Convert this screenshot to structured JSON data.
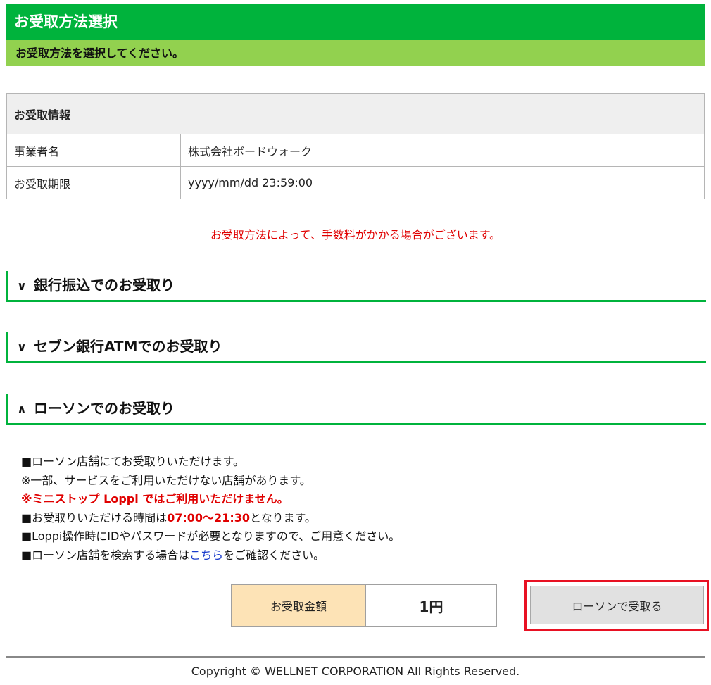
{
  "header": {
    "title": "お受取方法選択",
    "subtitle": "お受取方法を選択してください。"
  },
  "info": {
    "heading": "お受取情報",
    "rows": [
      {
        "label": "事業者名",
        "value": "株式会社ボードウォーク"
      },
      {
        "label": "お受取期限",
        "value": "yyyy/mm/dd 23:59:00"
      }
    ]
  },
  "notice": "お受取方法によって、手数料がかかる場合がございます。",
  "sections": [
    {
      "chevron": "∨",
      "title": "銀行振込でのお受取り",
      "expanded": false
    },
    {
      "chevron": "∨",
      "title": "セブン銀行ATMでのお受取り",
      "expanded": false
    },
    {
      "chevron": "∧",
      "title": "ローソンでのお受取り",
      "expanded": true
    }
  ],
  "lawson": {
    "line1": "■ローソン店舗にてお受取りいただけます。",
    "line2": "※一部、サービスをご利用いただけない店舗があります。",
    "line3": "※ミニストップ Loppi ではご利用いただけません。",
    "line4_prefix": "■お受取りいただける時間は",
    "line4_time": "07:00～21:30",
    "line4_suffix": "となります。",
    "line5": "■Loppi操作時にIDやパスワードが必要となりますので、ご用意ください。",
    "line6_prefix": "■ローソン店舗を検索する場合は",
    "line6_link": "こちら",
    "line6_suffix": "をご確認ください。"
  },
  "amount": {
    "label": "お受取金額",
    "value": "1円"
  },
  "action": {
    "button_label": "ローソンで受取る",
    "highlight_color": "#e81123"
  },
  "footer": {
    "copyright": "Copyright © WELLNET CORPORATION All Rights Reserved."
  },
  "colors": {
    "title_bg": "#00b33c",
    "subtitle_bg": "#92d14f",
    "notice_red": "#e00000",
    "amount_label_bg": "#fde3b6"
  }
}
